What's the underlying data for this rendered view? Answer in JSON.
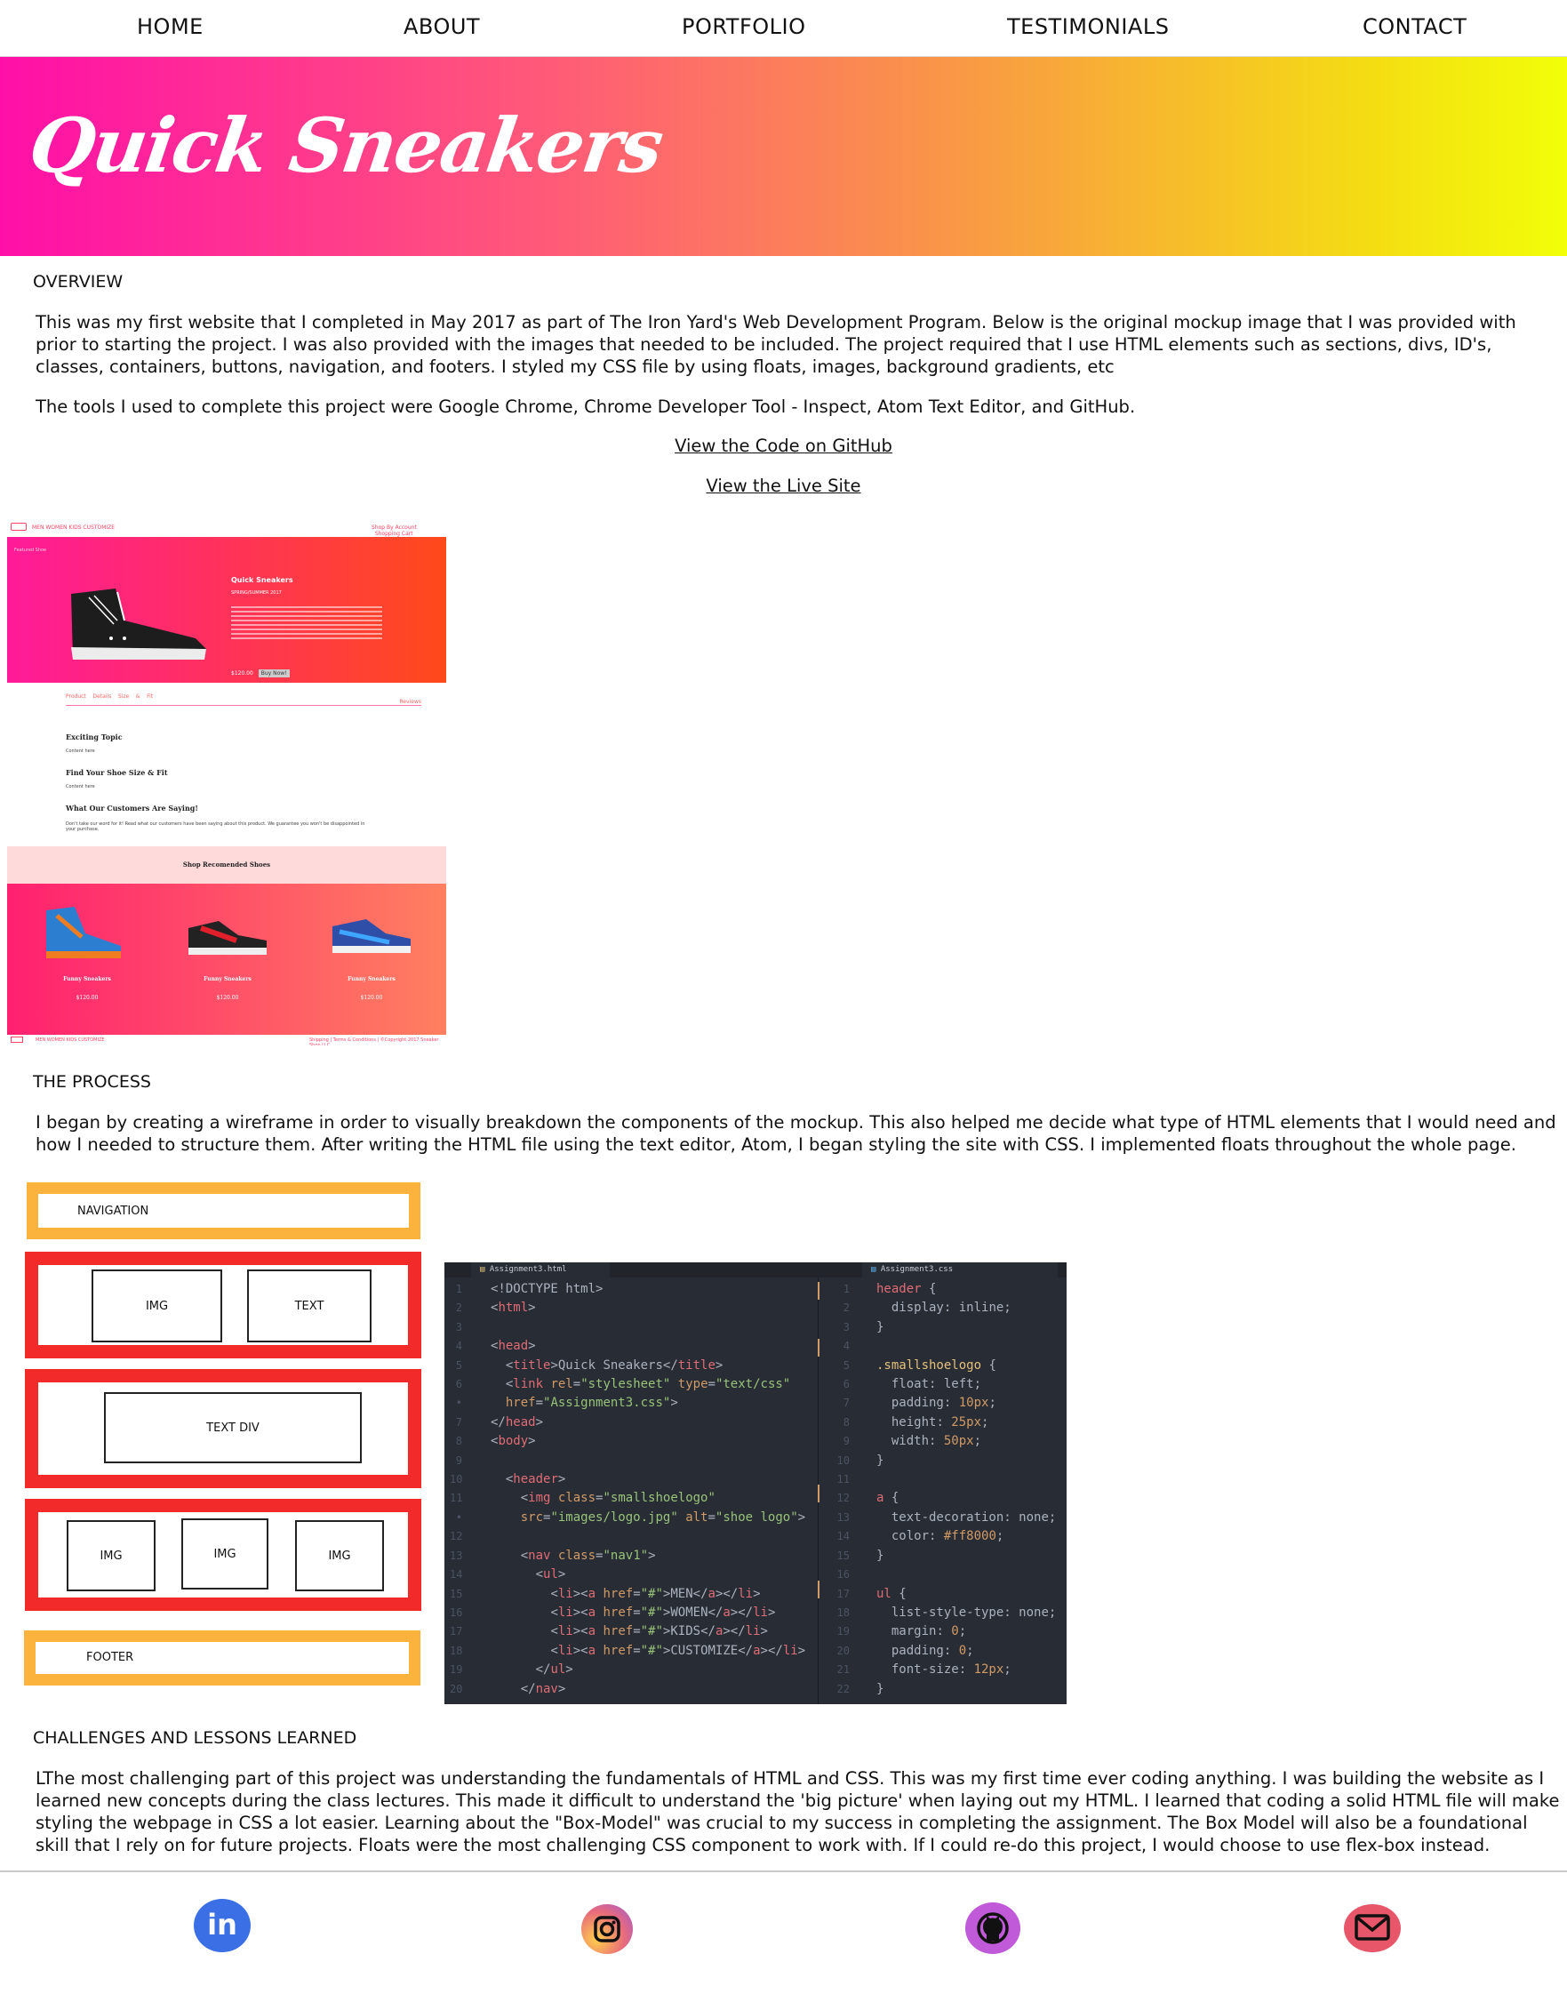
{
  "nav": {
    "items": [
      {
        "label": "HOME"
      },
      {
        "label": "ABOUT"
      },
      {
        "label": "PORTFOLIO"
      },
      {
        "label": "TESTIMONIALS"
      },
      {
        "label": "CONTACT"
      }
    ]
  },
  "hero": {
    "title": "Quick Sneakers",
    "gradient": [
      "#ff0fa8",
      "#f99a44",
      "#f2ff08"
    ]
  },
  "overview": {
    "heading": "OVERVIEW",
    "paragraph1": "This was my first website that I completed in May 2017 as part of The Iron Yard's Web Development Program. Below is the original mockup image that I was provided with prior to starting the project. I was also provided with the images that needed to be included. The project required that I use HTML elements such as sections, divs, ID's, classes, containers, buttons, navigation, and footers. I styled my CSS file by using floats, images, background gradients, etc",
    "paragraph2": "The tools I used to complete this project were Google Chrome, Chrome Developer Tool - Inspect, Atom Text Editor, and GitHub.",
    "link_code": "View the Code on GitHub",
    "link_live": "View the Live Site"
  },
  "mockup": {
    "topbar_left": "MEN WOMEN KIDS CUSTOMIZE",
    "topbar_right": "Shop By Account   Shopping Cart",
    "hero_tag": "Featured Shoe",
    "hero_title": "Quick Sneakers",
    "hero_sub": "SPRING/SUMMER 2017",
    "hero_price": "$120.00",
    "hero_button": "Buy Now!",
    "tabs": "Product    Details    Size    &    Fit",
    "tabs_right": "Reviews",
    "h1": "Exciting Topic",
    "h1_body": "Content here",
    "h2": "Find Your Shoe Size & Fit",
    "h2_body": "Content here",
    "h3": "What Our Customers Are Saying!",
    "h3_body": "Don't take our word for it! Read what our customers have been saying about this product. We guarantee you won't be disappointed in your purchase.",
    "band_title": "Shop Recomended Shoes",
    "products": [
      {
        "name": "Funny Sneakers",
        "price": "$120.00"
      },
      {
        "name": "Funny Sneakers",
        "price": "$120.00"
      },
      {
        "name": "Funny Sneakers",
        "price": "$120.00"
      }
    ],
    "footer_left": "MEN WOMEN KIDS CUSTOMIZE",
    "footer_right": "Shipping | Terms & Conditions | ©Copyright 2017 Sneaker Shop LLC."
  },
  "process": {
    "heading": "THE PROCESS",
    "paragraph": "I began by creating a wireframe in order to visually breakdown the components of the mockup. This also helped me decide what type of HTML elements that I would need and how I needed to structure them. After writing the HTML file using the text editor, Atom, I began styling the site with CSS. I implemented floats throughout the whole page."
  },
  "wireframe": {
    "navigation": "NAVIGATION",
    "img": "IMG",
    "text": "TEXT",
    "text_div": "TEXT DIV",
    "footer": "FOOTER"
  },
  "editor": {
    "tab_html": "Assignment3.html",
    "tab_css": "Assignment3.css"
  },
  "challenges": {
    "heading": "CHALLENGES AND LESSONS LEARNED",
    "paragraph": "LThe most challenging part of this project was understanding the fundamentals of HTML and CSS. This was my first time ever coding anything. I was building the website as I learned new concepts during the class lectures. This made it difficult to understand the 'big picture' when laying out my HTML. I learned that coding a solid HTML file will make styling the webpage in CSS a lot easier. Learning about the \"Box-Model\" was crucial to my success in completing the assignment. The Box Model will also be a foundational skill that I rely on for future projects. Floats were the most challenging CSS component to work with. If I could re-do this project, I would choose to use flex-box instead."
  },
  "footer": {
    "icons": [
      {
        "name": "linkedin-icon",
        "color": "#3a6fe6",
        "label": "in"
      },
      {
        "name": "instagram-icon",
        "color": "#e86b7c"
      },
      {
        "name": "github-icon",
        "color": "#c05ad8"
      },
      {
        "name": "email-icon",
        "color": "#e8566a"
      }
    ]
  }
}
